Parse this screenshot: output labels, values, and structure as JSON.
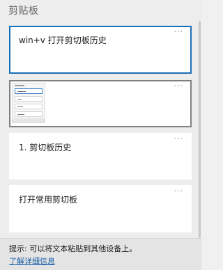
{
  "panel": {
    "title": "剪贴板"
  },
  "items": [
    {
      "text": "win+v 打开剪切板历史",
      "more": "···",
      "selected": true
    },
    {
      "type": "image",
      "more": "···"
    },
    {
      "text": "1. 剪切板历史",
      "more": "···"
    },
    {
      "text": "打开常用剪切板",
      "more": "···"
    }
  ],
  "footer": {
    "tip": "提示: 可以将文本粘贴到其他设备上。",
    "learn_more": "了解详细信息"
  },
  "colors": {
    "selected_border": "#1a6fb5",
    "link": "#1a5fa8"
  }
}
